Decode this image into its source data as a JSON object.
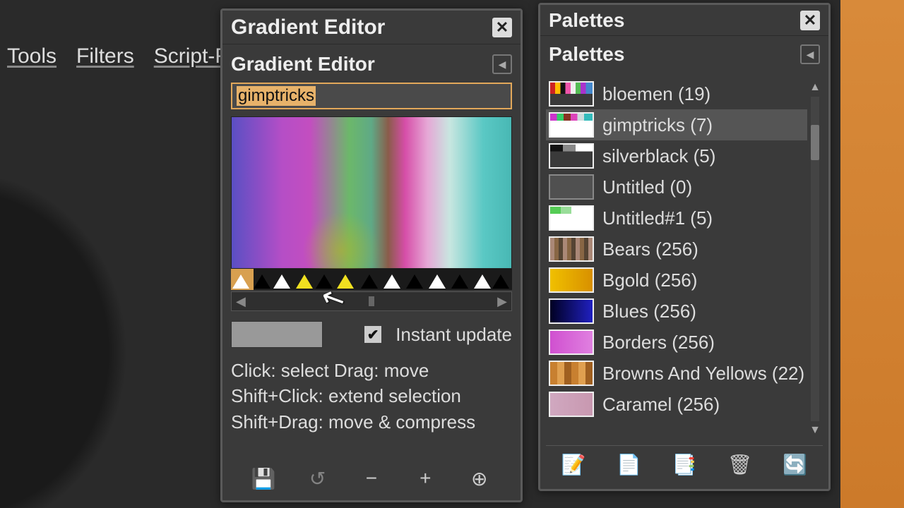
{
  "menubar": {
    "tools": "Tools",
    "filters": "Filters",
    "scriptfu": "Script-Fu"
  },
  "gradient_editor": {
    "window_title": "Gradient Editor",
    "panel_title": "Gradient Editor",
    "gradient_name": "gimptricks",
    "instant_update_label": "Instant update",
    "instant_update_checked": true,
    "help_line1": "Click: select   Drag: move",
    "help_line2": "Shift+Click: extend selection",
    "help_line3": "Shift+Drag: move & compress"
  },
  "palettes": {
    "window_title": "Palettes",
    "panel_title": "Palettes",
    "selected_index": 1,
    "items": [
      {
        "name": "bloemen",
        "count": 19,
        "label": "bloemen (19)"
      },
      {
        "name": "gimptricks",
        "count": 7,
        "label": "gimptricks (7)"
      },
      {
        "name": "silverblack",
        "count": 5,
        "label": "silverblack (5)"
      },
      {
        "name": "Untitled",
        "count": 0,
        "label": "Untitled (0)"
      },
      {
        "name": "Untitled#1",
        "count": 5,
        "label": "Untitled#1 (5)"
      },
      {
        "name": "Bears",
        "count": 256,
        "label": "Bears (256)"
      },
      {
        "name": "Bgold",
        "count": 256,
        "label": "Bgold (256)"
      },
      {
        "name": "Blues",
        "count": 256,
        "label": "Blues (256)"
      },
      {
        "name": "Borders",
        "count": 256,
        "label": "Borders (256)"
      },
      {
        "name": "Browns And Yellows",
        "count": 22,
        "label": "Browns And Yellows (22)"
      },
      {
        "name": "Caramel",
        "count": 256,
        "label": "Caramel (256)"
      }
    ]
  }
}
